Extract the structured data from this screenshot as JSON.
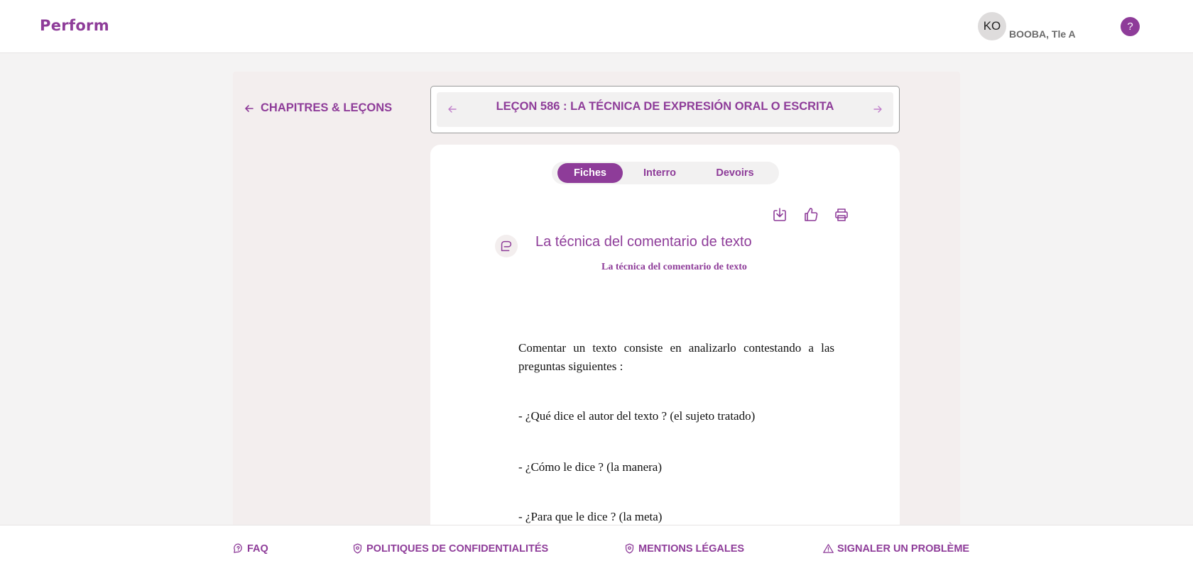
{
  "app": {
    "logo_text": "Perform",
    "brand_color": "#8e3c99"
  },
  "user": {
    "initials": "KO",
    "name": "BOOBA, Tle A"
  },
  "header": {
    "help_icon": "question-icon",
    "help_glyph": "?"
  },
  "sidebar": {
    "back_label": "CHAPITRES & LEÇONS",
    "back_icon": "arrow-left-icon"
  },
  "lesson": {
    "title": "LEÇON 586 : LA TÉCNICA DE EXPRESIÓN ORAL O ESCRITA",
    "prev_icon": "arrow-left-icon",
    "next_icon": "arrow-right-icon"
  },
  "tabs": [
    {
      "label": "Fiches",
      "active": true
    },
    {
      "label": "Interro",
      "active": false
    },
    {
      "label": "Devoirs",
      "active": false
    }
  ],
  "toolbar": {
    "icons": [
      "download-icon",
      "thumbs-up-icon",
      "print-icon"
    ]
  },
  "document": {
    "comment_icon": "comment-icon",
    "title": "La técnica del comentario de texto",
    "subtitle": "La técnica del comentario de texto",
    "paragraphs": [
      "Comentar un texto consiste en analizarlo contestando a las preguntas siguientes :",
      "- ¿Qué dice el autor del texto ? (el sujeto tratado)",
      "- ¿Cómo le dice ? (la manera)",
      "- ¿Para que le dice ? (la meta)"
    ]
  },
  "footer": {
    "links": [
      {
        "label": "FAQ",
        "icon": "faq-icon"
      },
      {
        "label": "POLITIQUES DE CONFIDENTIALITÉS",
        "icon": "shield-icon"
      },
      {
        "label": "MENTIONS LÉGALES",
        "icon": "shield-icon"
      },
      {
        "label": "SIGNALER UN PROBLÈME",
        "icon": "warning-icon"
      }
    ]
  }
}
